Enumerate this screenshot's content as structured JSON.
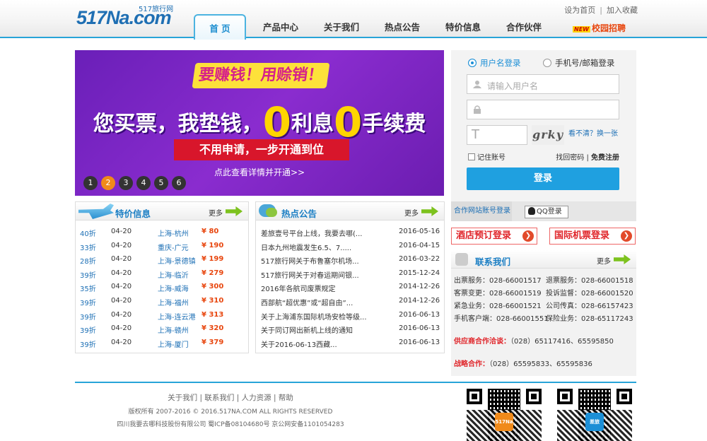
{
  "header": {
    "logo_text": "517Na.com",
    "logo_sub": "517旅行网",
    "links": [
      "设为首页",
      "加入收藏"
    ],
    "nav": [
      "首 页",
      "产品中心",
      "关于我们",
      "热点公告",
      "特价信息",
      "合作伙伴"
    ],
    "new_badge": "NEW",
    "campus": "校园招聘"
  },
  "banner": {
    "headline": "要赚钱！用赊销！",
    "main_a": "您买票，我垫钱，",
    "zero1": "0",
    "main_b": "利息",
    "zero2": "0",
    "main_c": "手续费",
    "ribbon": "不用申请，一步开通到位",
    "more": "点此查看详情并开通>>",
    "dots": [
      "1",
      "2",
      "3",
      "4",
      "5",
      "6"
    ],
    "active_dot": "2"
  },
  "login": {
    "tab_user": "用户名登录",
    "tab_phone": "手机号/邮箱登录",
    "username_placeholder": "请输入用户名",
    "captcha_placeholder": "T",
    "captcha_text": "grky",
    "captcha_change": "看不清？换一张",
    "remember": "记住账号",
    "forgot": "找回密码",
    "register": "免费注册",
    "submit": "登录"
  },
  "partner_login": {
    "label": "合作网站账号登录",
    "qq": "QQ登录"
  },
  "promos": {
    "hotel": "酒店预订登录",
    "intl": "国际机票登录"
  },
  "contact": {
    "title": "联系我们",
    "more": "更多",
    "rows": [
      [
        "出票服务：028-66001517",
        "退票服务：028-66001518"
      ],
      [
        "客票变更：028-66001519",
        "投诉监督：028-66001520"
      ],
      [
        "紧急业务：028-66001521",
        "公司传真：028-66157423"
      ],
      [
        "手机客户端：028-66001551",
        "保险业务：028-65117243"
      ]
    ],
    "supplier_label": "供应商合作洽谈：",
    "supplier_value": "（028）65117416、65595850",
    "strategic_label": "战略合作：",
    "strategic_value": "（028）65595833、65595836"
  },
  "specials": {
    "title": "特价信息",
    "more": "更多",
    "rows": [
      {
        "discount": "40折",
        "date": "04-20",
        "route": "上海-杭州",
        "price": "¥ 80"
      },
      {
        "discount": "33折",
        "date": "04-20",
        "route": "重庆-广元",
        "price": "¥ 190"
      },
      {
        "discount": "28折",
        "date": "04-20",
        "route": "上海-景德镇",
        "price": "¥ 199"
      },
      {
        "discount": "39折",
        "date": "04-20",
        "route": "上海-临沂",
        "price": "¥ 279"
      },
      {
        "discount": "35折",
        "date": "04-20",
        "route": "上海-威海",
        "price": "¥ 300"
      },
      {
        "discount": "39折",
        "date": "04-20",
        "route": "上海-福州",
        "price": "¥ 310"
      },
      {
        "discount": "39折",
        "date": "04-20",
        "route": "上海-连云港",
        "price": "¥ 313"
      },
      {
        "discount": "39折",
        "date": "04-20",
        "route": "上海-赣州",
        "price": "¥ 320"
      },
      {
        "discount": "39折",
        "date": "04-20",
        "route": "上海-厦门",
        "price": "¥ 379"
      }
    ]
  },
  "notices": {
    "title": "热点公告",
    "more": "更多",
    "rows": [
      {
        "text": "差旅壹号平台上线，我要去哪(...",
        "date": "2016-05-16"
      },
      {
        "text": "日本九州地震发生6.5、7.....",
        "date": "2016-04-15"
      },
      {
        "text": "517旅行网关于布鲁塞尔机场...",
        "date": "2016-03-22"
      },
      {
        "text": "517旅行网关于对春运期间银...",
        "date": "2015-12-24"
      },
      {
        "text": "2016年各航司废票规定",
        "date": "2014-12-26"
      },
      {
        "text": "西部航“超优惠”或“超自由”...",
        "date": "2014-12-26"
      },
      {
        "text": "关于上海浦东国际机场安检等级...",
        "date": "2016-06-13"
      },
      {
        "text": "关于同订网出新机上线的通知",
        "date": "2016-06-13"
      },
      {
        "text": "关于2016-06-13西藏...",
        "date": "2016-06-13"
      }
    ]
  },
  "footer": {
    "links": [
      "关于我们",
      "联系我们",
      "人力资源",
      "帮助"
    ],
    "copyright": "版权所有 2007-2016 © 2016.517NA.COM ALL RIGHTS RESERVED",
    "company": "四川我要去哪科技股份有限公司 蜀ICP备08104680号 京公网安备1101054283",
    "qr1_logo": "517Na",
    "qr2_logo": "差旅"
  },
  "colors": {
    "accent": "#27a4d8",
    "button": "#1fa0e0",
    "price": "#e8460e",
    "promo_red": "#e0252a"
  }
}
